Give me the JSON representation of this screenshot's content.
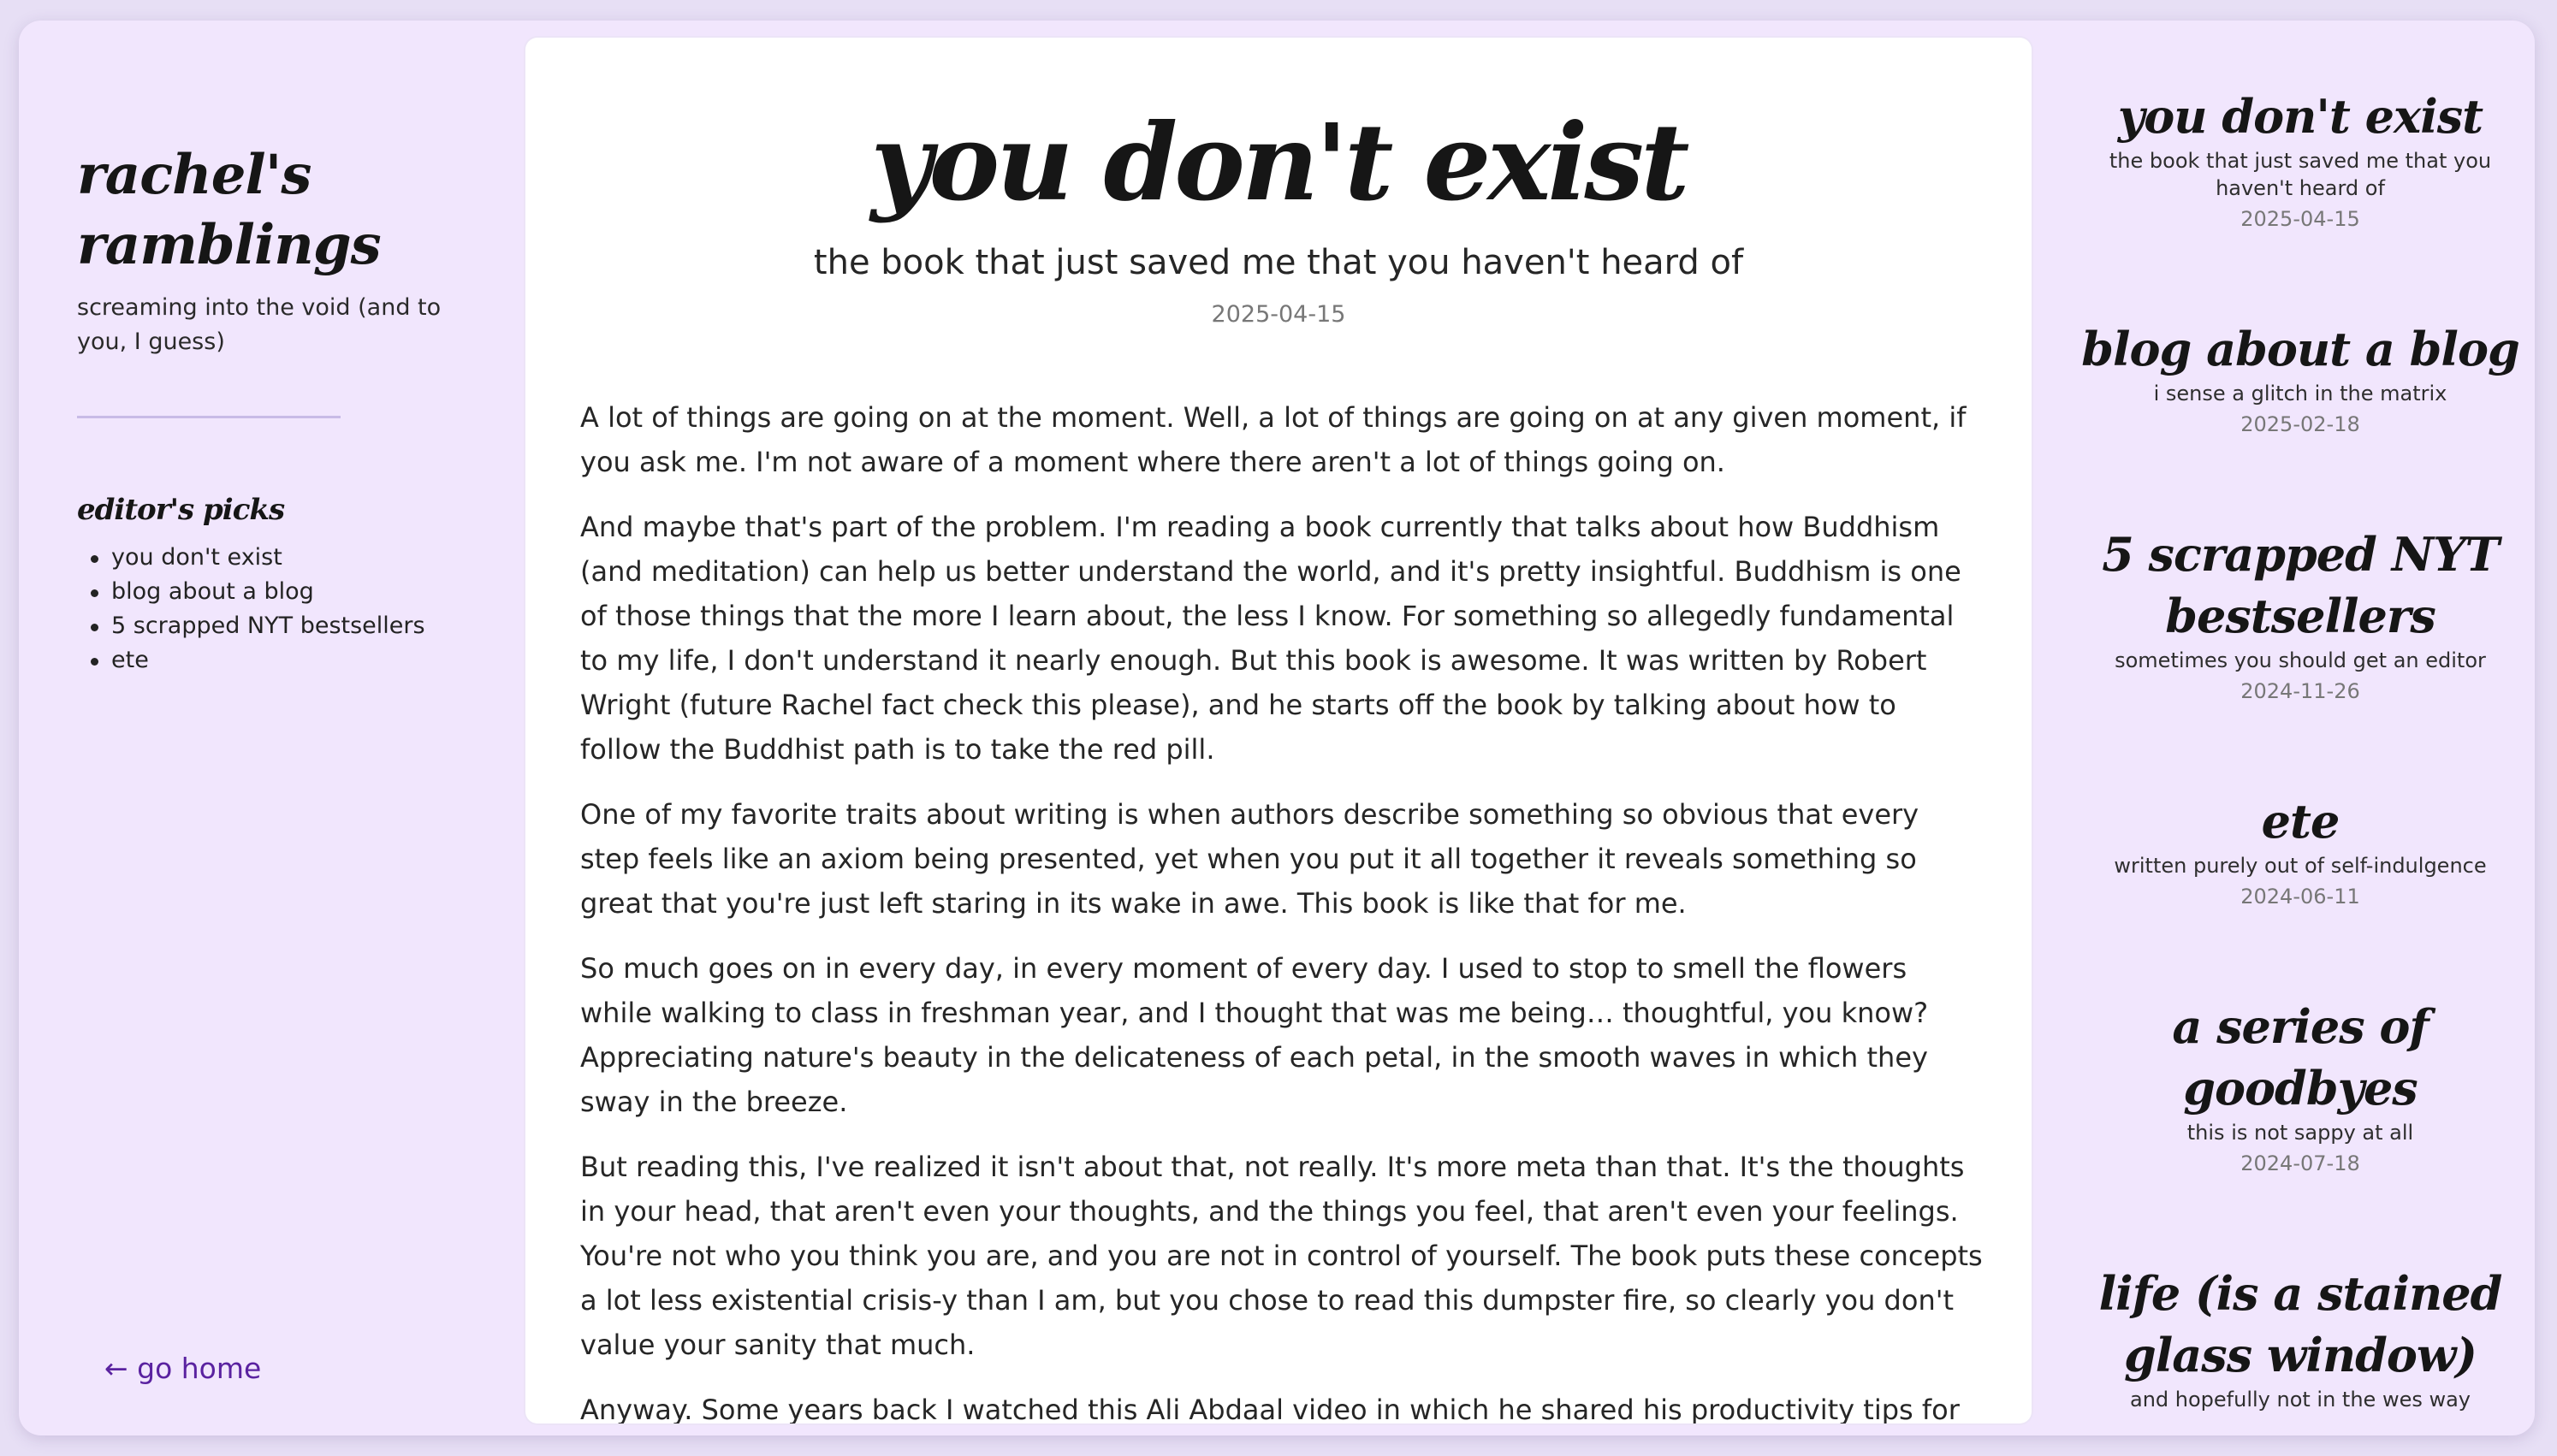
{
  "blog": {
    "title": "rachel's ramblings",
    "tagline": "screaming into the void (and to you, I guess)"
  },
  "editors_picks": {
    "heading": "editor's picks",
    "items": [
      "you don't exist",
      "blog about a blog",
      "5 scrapped NYT bestsellers",
      "ete"
    ]
  },
  "nav": {
    "go_home": "← go home"
  },
  "post": {
    "title": "you don't exist",
    "subtitle": "the book that just saved me that you haven't heard of",
    "date": "2025-04-15",
    "paragraphs": [
      "A lot of things are going on at the moment. Well, a lot of things are going on at any given moment, if you ask me. I'm not aware of a moment where there aren't a lot of things going on.",
      "And maybe that's part of the problem. I'm reading a book currently that talks about how Buddhism (and meditation) can help us better understand the world, and it's pretty insightful. Buddhism is one of those things that the more I learn about, the less I know. For something so allegedly fundamental to my life, I don't understand it nearly enough. But this book is awesome. It was written by Robert Wright (future Rachel fact check this please), and he starts off the book by talking about how to follow the Buddhist path is to take the red pill.",
      "One of my favorite traits about writing is when authors describe something so obvious that every step feels like an axiom being presented, yet when you put it all together it reveals something so great that you're just left staring in its wake in awe. This book is like that for me.",
      "So much goes on in every day, in every moment of every day. I used to stop to smell the flowers while walking to class in freshman year, and I thought that was me being… thoughtful, you know? Appreciating nature's beauty in the delicateness of each petal, in the smooth waves in which they sway in the breeze.",
      "But reading this, I've realized it isn't about that, not really. It's more meta than that. It's the thoughts in your head, that aren't even your thoughts, and the things you feel, that aren't even your feelings. You're not who you think you are, and you are not in control of yourself. The book puts these concepts a lot less existential crisis-y than I am, but you chose to read this dumpster fire, so clearly you don't value your sanity that much.",
      "Anyway. Some years back I watched this Ali Abdaal video in which he shared his productivity tips for"
    ]
  },
  "sidebar_posts": [
    {
      "title": "you don't exist",
      "subtitle": "the book that just saved me that you haven't heard of",
      "date": "2025-04-15"
    },
    {
      "title": "blog about a blog",
      "subtitle": "i sense a glitch in the matrix",
      "date": "2025-02-18"
    },
    {
      "title": "5 scrapped NYT bestsellers",
      "subtitle": "sometimes you should get an editor",
      "date": "2024-11-26"
    },
    {
      "title": "ete",
      "subtitle": "written purely out of self-indulgence",
      "date": "2024-06-11"
    },
    {
      "title": "a series of goodbyes",
      "subtitle": "this is not sappy at all",
      "date": "2024-07-18"
    },
    {
      "title": "life (is a stained glass window)",
      "subtitle": "and hopefully not in the wes way",
      "date": ""
    }
  ],
  "colors": {
    "background": "#f1e6fd",
    "card": "#ffffff",
    "accent_link": "#5a22a0",
    "divider": "#c8bbe6",
    "date_text": "#777777"
  }
}
